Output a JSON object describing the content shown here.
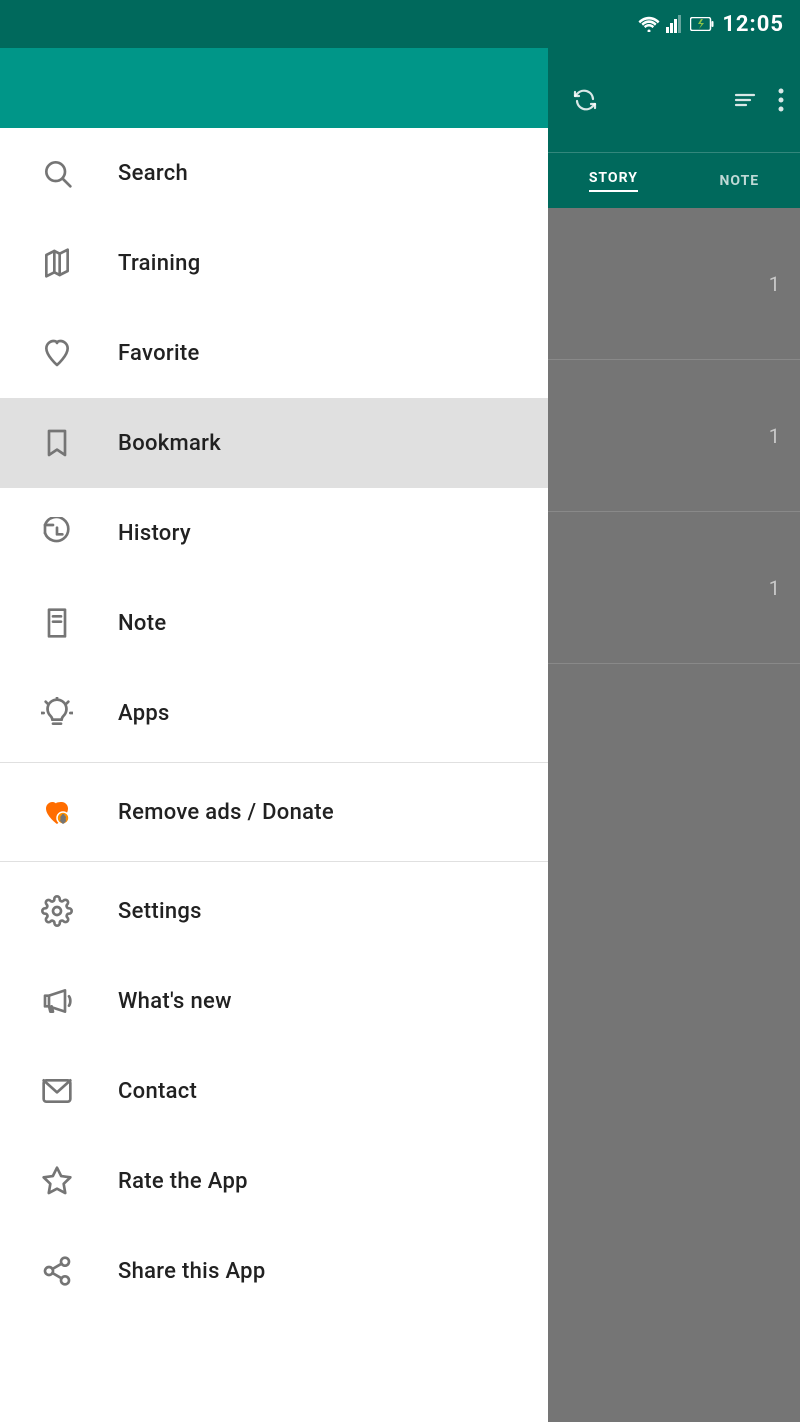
{
  "statusBar": {
    "time": "12:05"
  },
  "rightPanel": {
    "tab1": "STORY",
    "tab2": "NOTE",
    "numbers": [
      1,
      1,
      1
    ]
  },
  "drawer": {
    "menuItems": [
      {
        "id": "search",
        "label": "Search",
        "icon": "search",
        "active": false
      },
      {
        "id": "training",
        "label": "Training",
        "icon": "training",
        "active": false
      },
      {
        "id": "favorite",
        "label": "Favorite",
        "icon": "favorite",
        "active": false
      },
      {
        "id": "bookmark",
        "label": "Bookmark",
        "icon": "bookmark",
        "active": true
      },
      {
        "id": "history",
        "label": "History",
        "icon": "history",
        "active": false
      },
      {
        "id": "note",
        "label": "Note",
        "icon": "note",
        "active": false
      },
      {
        "id": "apps",
        "label": "Apps",
        "icon": "apps",
        "active": false
      }
    ],
    "donate": {
      "id": "donate",
      "label": "Remove ads / Donate",
      "icon": "donate"
    },
    "bottomItems": [
      {
        "id": "settings",
        "label": "Settings",
        "icon": "settings"
      },
      {
        "id": "whatsnew",
        "label": "What's new",
        "icon": "whatsnew"
      },
      {
        "id": "contact",
        "label": "Contact",
        "icon": "contact"
      },
      {
        "id": "rate",
        "label": "Rate the App",
        "icon": "rate"
      },
      {
        "id": "share",
        "label": "Share this App",
        "icon": "share"
      }
    ]
  }
}
